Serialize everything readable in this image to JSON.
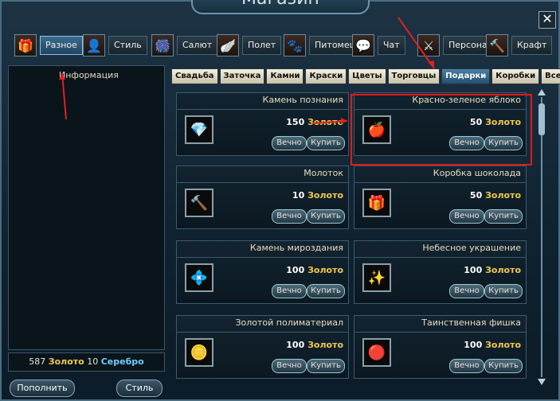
{
  "title": "Магазин",
  "close_label": "✕",
  "categories": [
    {
      "label": "Разное",
      "icon": "gift-icon",
      "glyph": "🎁"
    },
    {
      "label": "Стиль",
      "icon": "costume-icon",
      "glyph": "👤"
    },
    {
      "label": "Салют",
      "icon": "firework-icon",
      "glyph": "🎆"
    },
    {
      "label": "Полет",
      "icon": "wing-icon",
      "glyph": "🪽"
    },
    {
      "label": "Питомец",
      "icon": "pet-icon",
      "glyph": "🐾"
    },
    {
      "label": "Чат",
      "icon": "chat-icon",
      "glyph": "💬"
    },
    {
      "label": "Персонаж",
      "icon": "character-icon",
      "glyph": "⚔"
    },
    {
      "label": "Крафт",
      "icon": "craft-icon",
      "glyph": "🔨"
    }
  ],
  "info_label": "Информация",
  "balance": {
    "gold_amount": "587",
    "gold_label": "Золото",
    "silver_amount": "10",
    "silver_label": "Серебро"
  },
  "buttons": {
    "topup": "Пополнить",
    "style": "Стиль"
  },
  "tabs": [
    "Свадьба",
    "Заточка",
    "Камни",
    "Краски",
    "Цветы",
    "Торговцы",
    "Подарки",
    "Коробки",
    "Все"
  ],
  "items": [
    {
      "name": "Камень познания",
      "amount": "150",
      "currency": "Золото",
      "forever": "Вечно",
      "buy": "Купить",
      "icon": "red-gem-icon",
      "glyph": "💎"
    },
    {
      "name": "Красно-зеленое яблоко",
      "amount": "50",
      "currency": "Золото",
      "forever": "Вечно",
      "buy": "Купить",
      "icon": "apple-icon",
      "glyph": "🍎"
    },
    {
      "name": "Молоток",
      "amount": "10",
      "currency": "Золото",
      "forever": "Вечно",
      "buy": "Купить",
      "icon": "hammer-icon",
      "glyph": "🔨"
    },
    {
      "name": "Коробка шоколада",
      "amount": "50",
      "currency": "Золото",
      "forever": "Вечно",
      "buy": "Купить",
      "icon": "chocolate-box-icon",
      "glyph": "🎁"
    },
    {
      "name": "Камень мироздания",
      "amount": "100",
      "currency": "Золото",
      "forever": "Вечно",
      "buy": "Купить",
      "icon": "crystal-icon",
      "glyph": "💠"
    },
    {
      "name": "Небесное украшение",
      "amount": "100",
      "currency": "Золото",
      "forever": "Вечно",
      "buy": "Купить",
      "icon": "ornament-icon",
      "glyph": "✨"
    },
    {
      "name": "Золотой полиматериал",
      "amount": "100",
      "currency": "Золото",
      "forever": "Вечно",
      "buy": "Купить",
      "icon": "gold-ore-icon",
      "glyph": "🪙"
    },
    {
      "name": "Таинственная фишка",
      "amount": "100",
      "currency": "Золото",
      "forever": "Вечно",
      "buy": "Купить",
      "icon": "token-icon",
      "glyph": "🔴"
    }
  ],
  "colors": {
    "gold": "#f2c94c",
    "silver": "#6ed0ff",
    "highlight": "#e21a1a"
  }
}
